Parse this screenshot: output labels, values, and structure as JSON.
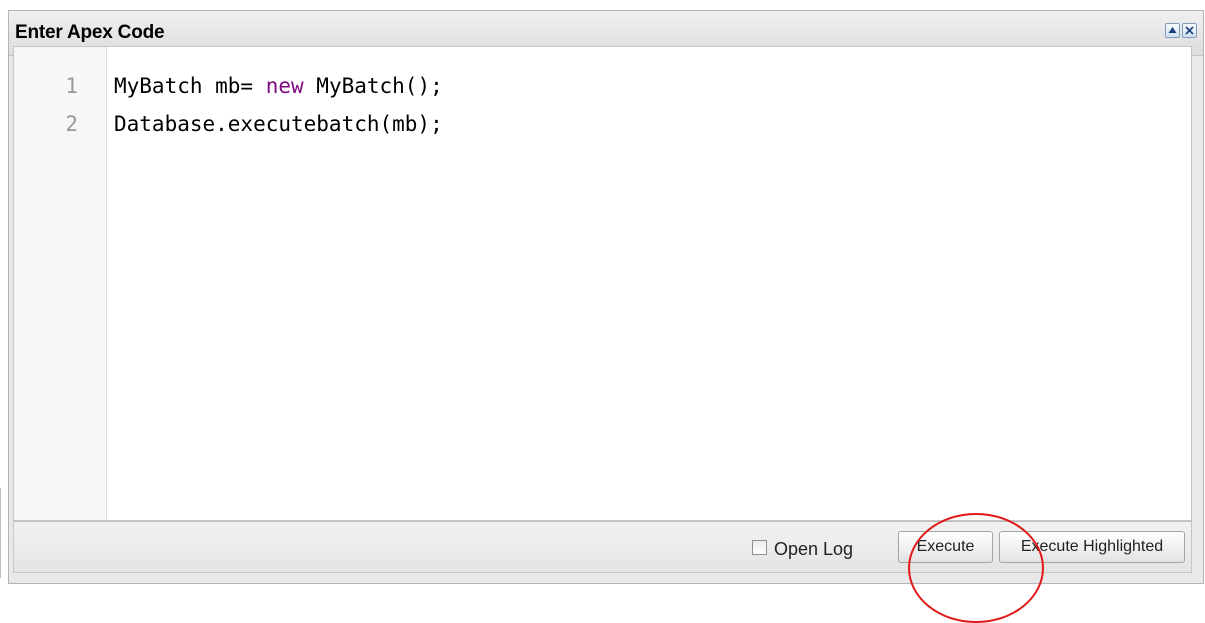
{
  "panel": {
    "title": "Enter Apex Code"
  },
  "window_controls": {
    "collapse_icon": "triangle-up-icon",
    "close_icon": "close-icon"
  },
  "editor": {
    "lines": [
      {
        "number": "1",
        "before": "MyBatch mb= ",
        "keyword": "new",
        "after": " MyBatch();"
      },
      {
        "number": "2",
        "before": "Database.executebatch(mb);",
        "keyword": "",
        "after": ""
      }
    ],
    "colors": {
      "keyword": "#7f0a83",
      "text": "#000000",
      "line_number": "#999999"
    }
  },
  "footer": {
    "open_log_label": "Open Log",
    "open_log_checked": false,
    "execute_label": "Execute",
    "execute_highlighted_label": "Execute Highlighted"
  },
  "annotation": {
    "shape": "ellipse",
    "color": "#e01818"
  }
}
